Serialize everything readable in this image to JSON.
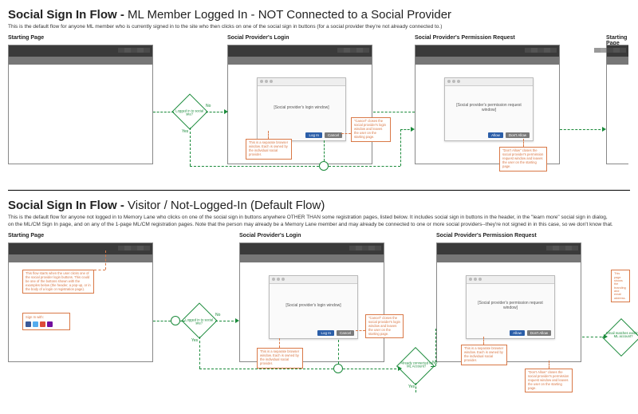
{
  "section1": {
    "title_bold": "Social Sign In Flow - ",
    "title_light": "ML Member Logged In - NOT Connected to a Social Provider",
    "subtitle": "This is the default flow for anyone ML member who is currently signed in to the site who then clicks on one of the social sign in buttons (for a social provider they're not already connected to.)",
    "panels": {
      "p1": "Starting Page",
      "p2": "Social Provider's Login",
      "p3": "Social Provider's Permission Request",
      "p4": "Starting Page"
    },
    "dialogs": {
      "login_body": "[Social provider's login window]",
      "perm_body": "[Social provider's permission request window]",
      "btn_login": "Log In",
      "btn_cancel": "Cancel",
      "btn_allow": "Allow",
      "btn_dont": "Don't Allow"
    },
    "decision1": {
      "label": "Logged in to social site?",
      "yes": "Yes",
      "no": "No"
    },
    "notes": {
      "n1": "This is a separate browser window. Each is owned by the individual social provider.",
      "n2": "\"Cancel\" closes the social provider's login window and leaves the user on the starting page.",
      "n3": "\"Don't Allow\" closes the social provider's permission request window and leaves the user on the starting page."
    }
  },
  "section2": {
    "title_bold": "Social Sign In Flow - ",
    "title_light": "Visitor / Not-Logged-In (Default Flow)",
    "subtitle": "This is the default flow for anyone not logged in to Memory Lane who clicks on one of the social sign in buttons anywhere OTHER THAN some registration pages, listed below. It includes social sign in buttons in the header, in the \"learn more\" social sign in dialog, on the ML/CM Sign In page, and on any of the 1-page ML/CM registration pages. Note that the person may already be a Memory Lane member and may already be connected to one or more social providers--they're not signed in in this case, so we don't know that.",
    "panels": {
      "p1": "Starting Page",
      "p2": "Social Provider's Login",
      "p3": "Social Provider's Permission Request"
    },
    "dialogs": {
      "login_body": "[Social provider's login window]",
      "perm_body": "[Social provider's permission request window]",
      "btn_login": "Log In",
      "btn_cancel": "Cancel",
      "btn_allow": "Allow",
      "btn_dont": "Don't Allow"
    },
    "decision1": {
      "label": "Logged in to social site?",
      "yes": "Yes",
      "no": "No"
    },
    "decision2": {
      "label": "Already connected to ML Account?",
      "yes": "Yes",
      "no": "No"
    },
    "decision3": {
      "label": "Email matches existing ML account?"
    },
    "notes": {
      "n_start": "This flow starts when the user clicks one of the social provider login buttons. This could be one of the buttons shown with the examples below (the header, a pop-up, or in the body of a login or registration page).",
      "n_signin": "Sign In with:",
      "n_sep": "This is a separate browser window. Each is owned by the individual social provider.",
      "n_cancel": "\"Cancel\" closes the social provider's login window and leaves the user on the starting page.",
      "n_sep2": "This is a separate browser window. Each is owned by the individual social provider.",
      "n_dont": "\"Don't Allow\" closes the social provider's permission request window and leaves the user on the starting page.",
      "n_cut": "This page shows the branding and email address."
    }
  }
}
